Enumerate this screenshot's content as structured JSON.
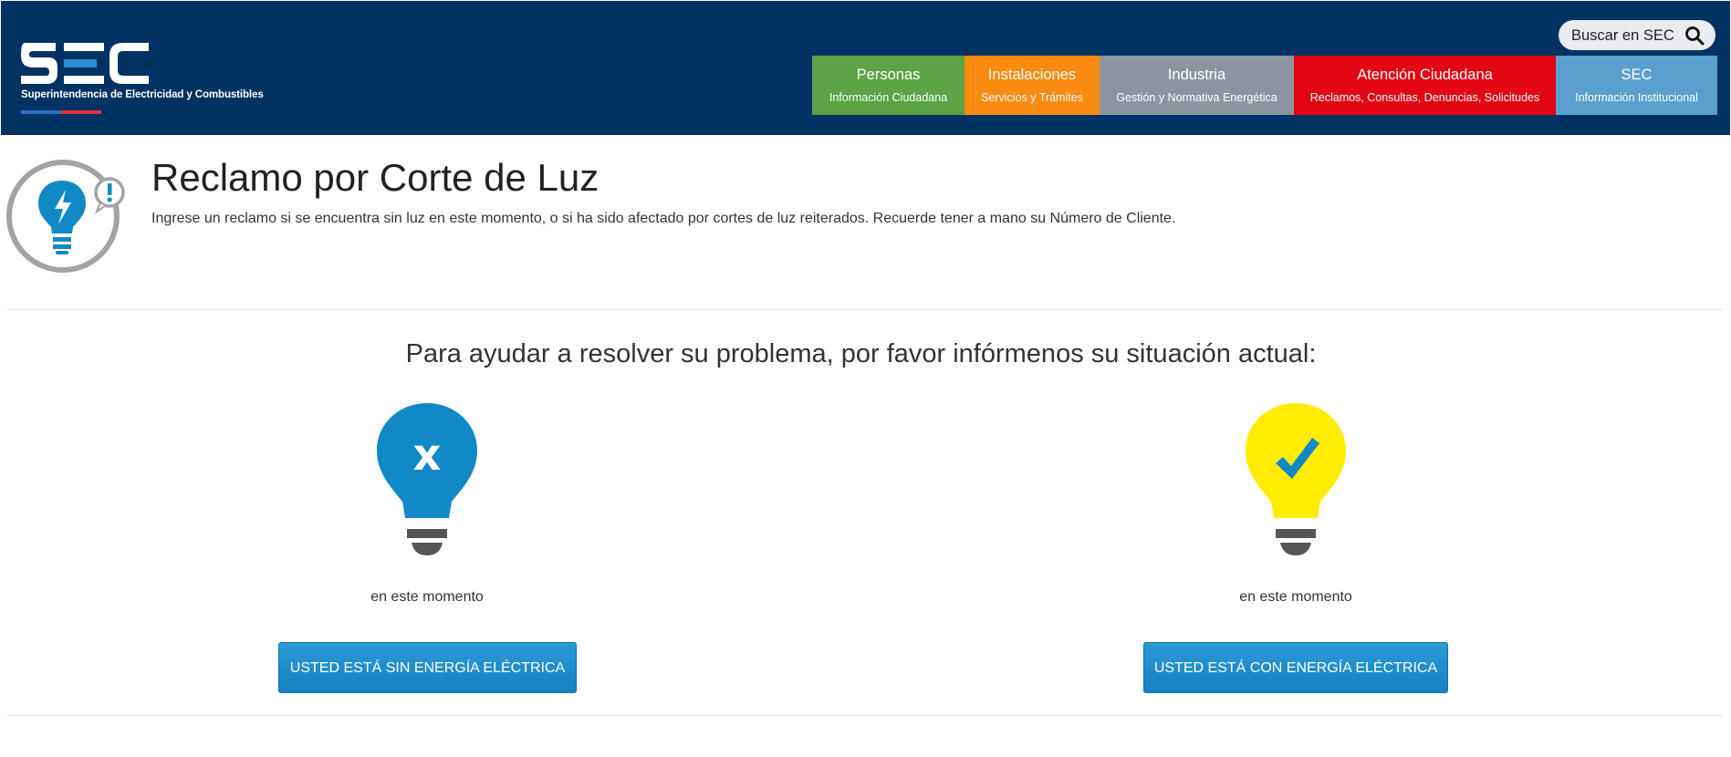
{
  "header": {
    "logo_text": "SEC",
    "logo_subtitle": "Superintendencia de Electricidad y Combustibles",
    "search_placeholder": "Buscar en SEC",
    "nav": [
      {
        "title": "Personas",
        "subtitle": "Información Ciudadana",
        "color": "#5ba344"
      },
      {
        "title": "Instalaciones",
        "subtitle": "Servicios y Trámites",
        "color": "#fa8a10"
      },
      {
        "title": "Industria",
        "subtitle": "Gestión y Normativa Energética",
        "color": "#8c96a0"
      },
      {
        "title": "Atención Ciudadana",
        "subtitle": "Reclamos, Consultas, Denuncias, Solicitudes",
        "color": "#e20613"
      },
      {
        "title": "SEC",
        "subtitle": "Información Institucional",
        "color": "#5aa0cf"
      }
    ],
    "background": "#003263"
  },
  "main": {
    "title": "Reclamo por Corte de Luz",
    "description": "Ingrese un reclamo si se encuentra sin luz en este momento, o si ha sido afectado por cortes de luz reiterados. Recuerde tener a mano su Número de Cliente.",
    "question": "Para ayudar a resolver su problema, por favor infórmenos su situación actual:",
    "options": [
      {
        "icon": "bulb-off-x-icon",
        "bulb_color": "#1189c6",
        "label": "en este momento",
        "button": "USTED ESTÁ SIN ENERGÍA ELÉCTRICA"
      },
      {
        "icon": "bulb-on-check-icon",
        "bulb_color": "#ffec00",
        "label": "en este momento",
        "button": "USTED ESTÁ CON ENERGÍA ELÉCTRICA"
      }
    ]
  }
}
